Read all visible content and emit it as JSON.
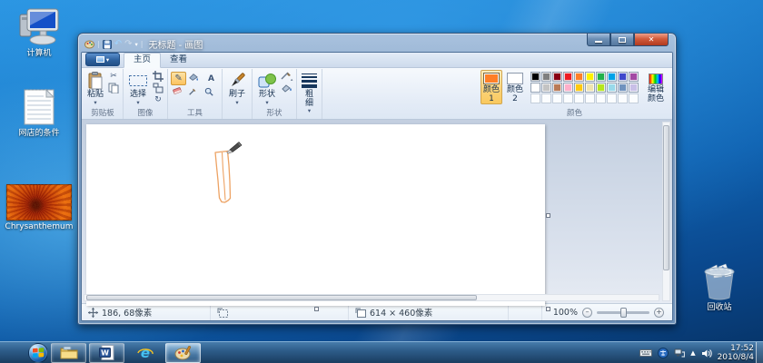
{
  "desktop": {
    "icons": [
      {
        "label": "计算机"
      },
      {
        "label": "网店的条件"
      },
      {
        "label": "Chrysanthemum"
      },
      {
        "label": "回收站"
      }
    ]
  },
  "window": {
    "title": "无标题 - 画图",
    "tabs": [
      {
        "label": "主页"
      },
      {
        "label": "查看"
      }
    ],
    "ribbon": {
      "paste": "粘贴",
      "select": "选择",
      "brush": "刷子",
      "shapes": "形状",
      "size": "粗细",
      "color1": "颜色 1",
      "color2": "颜色 2",
      "edit_colors": "编辑颜色",
      "groups": [
        "剪贴板",
        "图像",
        "工具",
        "形状",
        "颜色"
      ],
      "color1_value": "#FF7F27",
      "color2_value": "#FFFFFF",
      "palette_row1": [
        "#000000",
        "#7F7F7F",
        "#880015",
        "#ED1C24",
        "#FF7F27",
        "#FFF200",
        "#22B14C",
        "#00A2E8",
        "#3F48CC",
        "#A349A4"
      ],
      "palette_row2": [
        "#FFFFFF",
        "#C3C3C3",
        "#B97A57",
        "#FFAEC9",
        "#FFC90E",
        "#EFE4B0",
        "#B5E61D",
        "#99D9EA",
        "#7092BE",
        "#C8BFE7"
      ]
    },
    "status": {
      "cursor": "186, 68像素",
      "canvas_size": "614 × 460像素",
      "zoom": "100%"
    },
    "drawing_color": "#EDA263"
  },
  "taskbar": {
    "clock": {
      "time": "17:52",
      "date": "2010/8/4"
    }
  },
  "glyphs": {
    "close": "✕",
    "cut": "✂",
    "undo": "↶",
    "redo": "↷",
    "rotate": "↻",
    "pencil": "✎",
    "text_tool": "A",
    "hidden_icons": "▲",
    "zoom_out": "–",
    "zoom_in": "+",
    "caret": "▾"
  }
}
